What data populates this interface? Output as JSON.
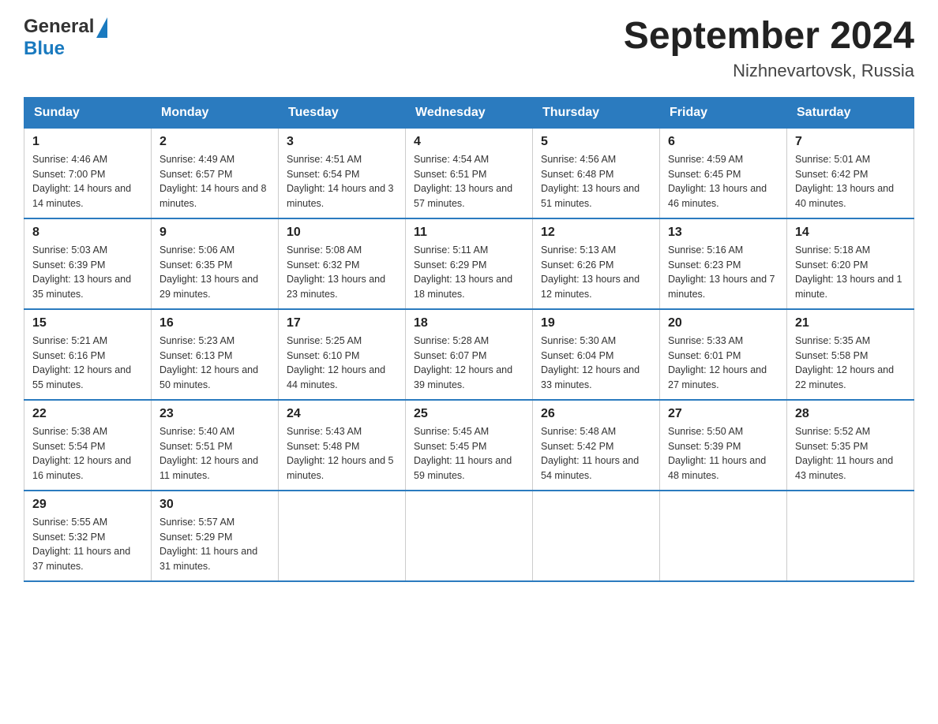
{
  "header": {
    "logo_text_general": "General",
    "logo_text_blue": "Blue",
    "title": "September 2024",
    "subtitle": "Nizhnevartovsk, Russia"
  },
  "days_of_week": [
    "Sunday",
    "Monday",
    "Tuesday",
    "Wednesday",
    "Thursday",
    "Friday",
    "Saturday"
  ],
  "weeks": [
    [
      {
        "day": "1",
        "sunrise": "4:46 AM",
        "sunset": "7:00 PM",
        "daylight": "14 hours and 14 minutes."
      },
      {
        "day": "2",
        "sunrise": "4:49 AM",
        "sunset": "6:57 PM",
        "daylight": "14 hours and 8 minutes."
      },
      {
        "day": "3",
        "sunrise": "4:51 AM",
        "sunset": "6:54 PM",
        "daylight": "14 hours and 3 minutes."
      },
      {
        "day": "4",
        "sunrise": "4:54 AM",
        "sunset": "6:51 PM",
        "daylight": "13 hours and 57 minutes."
      },
      {
        "day": "5",
        "sunrise": "4:56 AM",
        "sunset": "6:48 PM",
        "daylight": "13 hours and 51 minutes."
      },
      {
        "day": "6",
        "sunrise": "4:59 AM",
        "sunset": "6:45 PM",
        "daylight": "13 hours and 46 minutes."
      },
      {
        "day": "7",
        "sunrise": "5:01 AM",
        "sunset": "6:42 PM",
        "daylight": "13 hours and 40 minutes."
      }
    ],
    [
      {
        "day": "8",
        "sunrise": "5:03 AM",
        "sunset": "6:39 PM",
        "daylight": "13 hours and 35 minutes."
      },
      {
        "day": "9",
        "sunrise": "5:06 AM",
        "sunset": "6:35 PM",
        "daylight": "13 hours and 29 minutes."
      },
      {
        "day": "10",
        "sunrise": "5:08 AM",
        "sunset": "6:32 PM",
        "daylight": "13 hours and 23 minutes."
      },
      {
        "day": "11",
        "sunrise": "5:11 AM",
        "sunset": "6:29 PM",
        "daylight": "13 hours and 18 minutes."
      },
      {
        "day": "12",
        "sunrise": "5:13 AM",
        "sunset": "6:26 PM",
        "daylight": "13 hours and 12 minutes."
      },
      {
        "day": "13",
        "sunrise": "5:16 AM",
        "sunset": "6:23 PM",
        "daylight": "13 hours and 7 minutes."
      },
      {
        "day": "14",
        "sunrise": "5:18 AM",
        "sunset": "6:20 PM",
        "daylight": "13 hours and 1 minute."
      }
    ],
    [
      {
        "day": "15",
        "sunrise": "5:21 AM",
        "sunset": "6:16 PM",
        "daylight": "12 hours and 55 minutes."
      },
      {
        "day": "16",
        "sunrise": "5:23 AM",
        "sunset": "6:13 PM",
        "daylight": "12 hours and 50 minutes."
      },
      {
        "day": "17",
        "sunrise": "5:25 AM",
        "sunset": "6:10 PM",
        "daylight": "12 hours and 44 minutes."
      },
      {
        "day": "18",
        "sunrise": "5:28 AM",
        "sunset": "6:07 PM",
        "daylight": "12 hours and 39 minutes."
      },
      {
        "day": "19",
        "sunrise": "5:30 AM",
        "sunset": "6:04 PM",
        "daylight": "12 hours and 33 minutes."
      },
      {
        "day": "20",
        "sunrise": "5:33 AM",
        "sunset": "6:01 PM",
        "daylight": "12 hours and 27 minutes."
      },
      {
        "day": "21",
        "sunrise": "5:35 AM",
        "sunset": "5:58 PM",
        "daylight": "12 hours and 22 minutes."
      }
    ],
    [
      {
        "day": "22",
        "sunrise": "5:38 AM",
        "sunset": "5:54 PM",
        "daylight": "12 hours and 16 minutes."
      },
      {
        "day": "23",
        "sunrise": "5:40 AM",
        "sunset": "5:51 PM",
        "daylight": "12 hours and 11 minutes."
      },
      {
        "day": "24",
        "sunrise": "5:43 AM",
        "sunset": "5:48 PM",
        "daylight": "12 hours and 5 minutes."
      },
      {
        "day": "25",
        "sunrise": "5:45 AM",
        "sunset": "5:45 PM",
        "daylight": "11 hours and 59 minutes."
      },
      {
        "day": "26",
        "sunrise": "5:48 AM",
        "sunset": "5:42 PM",
        "daylight": "11 hours and 54 minutes."
      },
      {
        "day": "27",
        "sunrise": "5:50 AM",
        "sunset": "5:39 PM",
        "daylight": "11 hours and 48 minutes."
      },
      {
        "day": "28",
        "sunrise": "5:52 AM",
        "sunset": "5:35 PM",
        "daylight": "11 hours and 43 minutes."
      }
    ],
    [
      {
        "day": "29",
        "sunrise": "5:55 AM",
        "sunset": "5:32 PM",
        "daylight": "11 hours and 37 minutes."
      },
      {
        "day": "30",
        "sunrise": "5:57 AM",
        "sunset": "5:29 PM",
        "daylight": "11 hours and 31 minutes."
      },
      null,
      null,
      null,
      null,
      null
    ]
  ]
}
